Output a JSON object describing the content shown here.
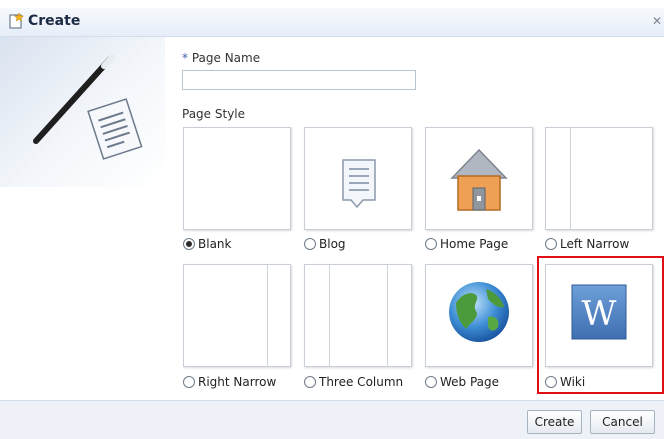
{
  "dialog": {
    "title": "Create"
  },
  "form": {
    "required_marker": "*",
    "page_name_label": "Page Name",
    "page_name_value": "",
    "page_style_label": "Page Style"
  },
  "styles": [
    {
      "label": "Blank",
      "selected": true,
      "icon": "blank-layout"
    },
    {
      "label": "Blog",
      "selected": false,
      "icon": "document-icon"
    },
    {
      "label": "Home Page",
      "selected": false,
      "icon": "house-icon"
    },
    {
      "label": "Left Narrow",
      "selected": false,
      "icon": "left-narrow-layout"
    },
    {
      "label": "Right Narrow",
      "selected": false,
      "icon": "right-narrow-layout"
    },
    {
      "label": "Three Column",
      "selected": false,
      "icon": "three-column-layout"
    },
    {
      "label": "Web Page",
      "selected": false,
      "icon": "globe-icon"
    },
    {
      "label": "Wiki",
      "selected": false,
      "icon": "wiki-w-icon"
    }
  ],
  "buttons": {
    "create": "Create",
    "cancel": "Cancel"
  },
  "colors": {
    "highlight": "#e00f17",
    "wiki_blue": "#4a7fc1"
  }
}
